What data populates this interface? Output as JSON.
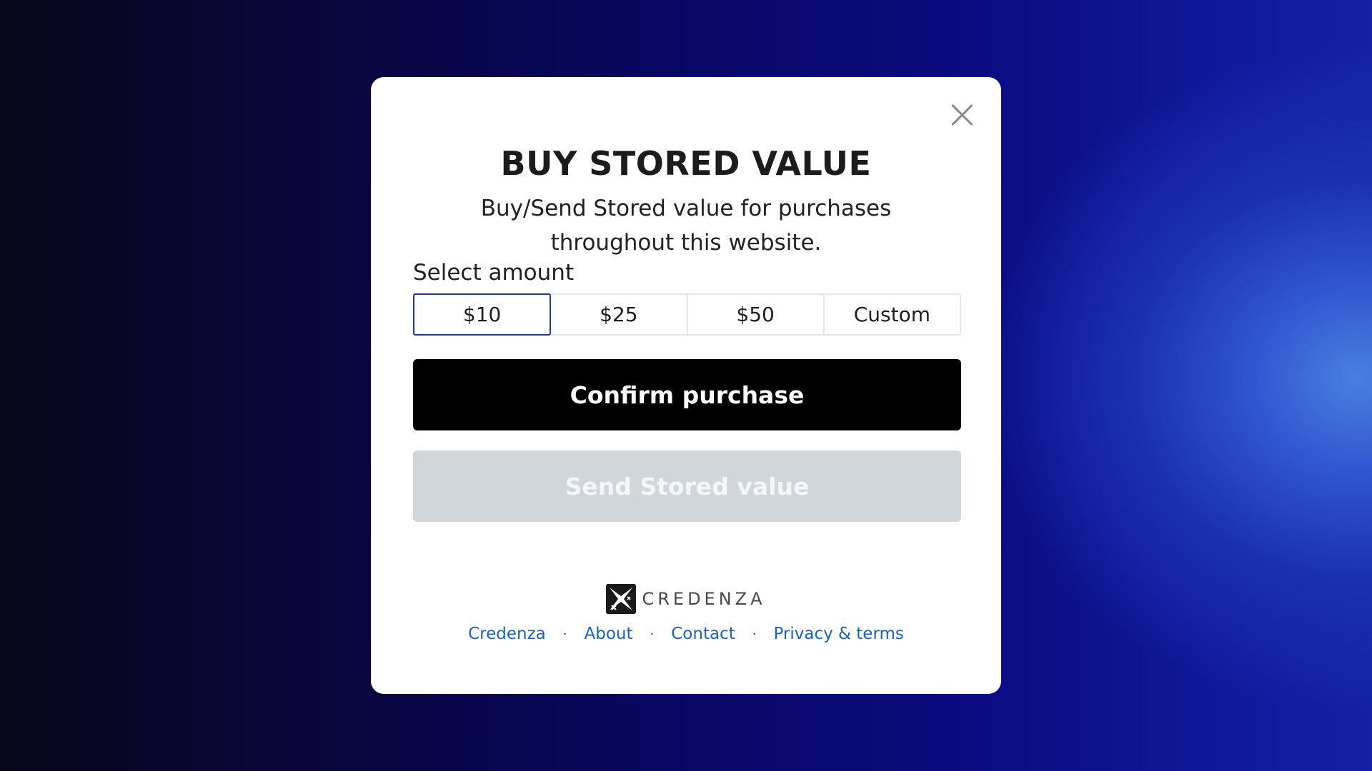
{
  "modal": {
    "title": "BUY STORED VALUE",
    "subtitle": "Buy/Send Stored value for purchases throughout this website.",
    "select_label": "Select amount",
    "amounts": [
      "$10",
      "$25",
      "$50",
      "Custom"
    ],
    "selected_amount": "$10",
    "confirm_label": "Confirm purchase",
    "send_label": "Send Stored value",
    "brand_name": "CREDENZA",
    "footer_links": [
      "Credenza",
      "About",
      "Contact",
      "Privacy & terms"
    ],
    "footer_separator": "·",
    "icons": {
      "close": "close-icon",
      "brand": "credenza-logo-icon"
    }
  },
  "colors": {
    "selected_border": "#1f3b8f",
    "link": "#1c63b8",
    "confirm_bg": "#000000",
    "disabled_bg": "#d1d6db"
  }
}
